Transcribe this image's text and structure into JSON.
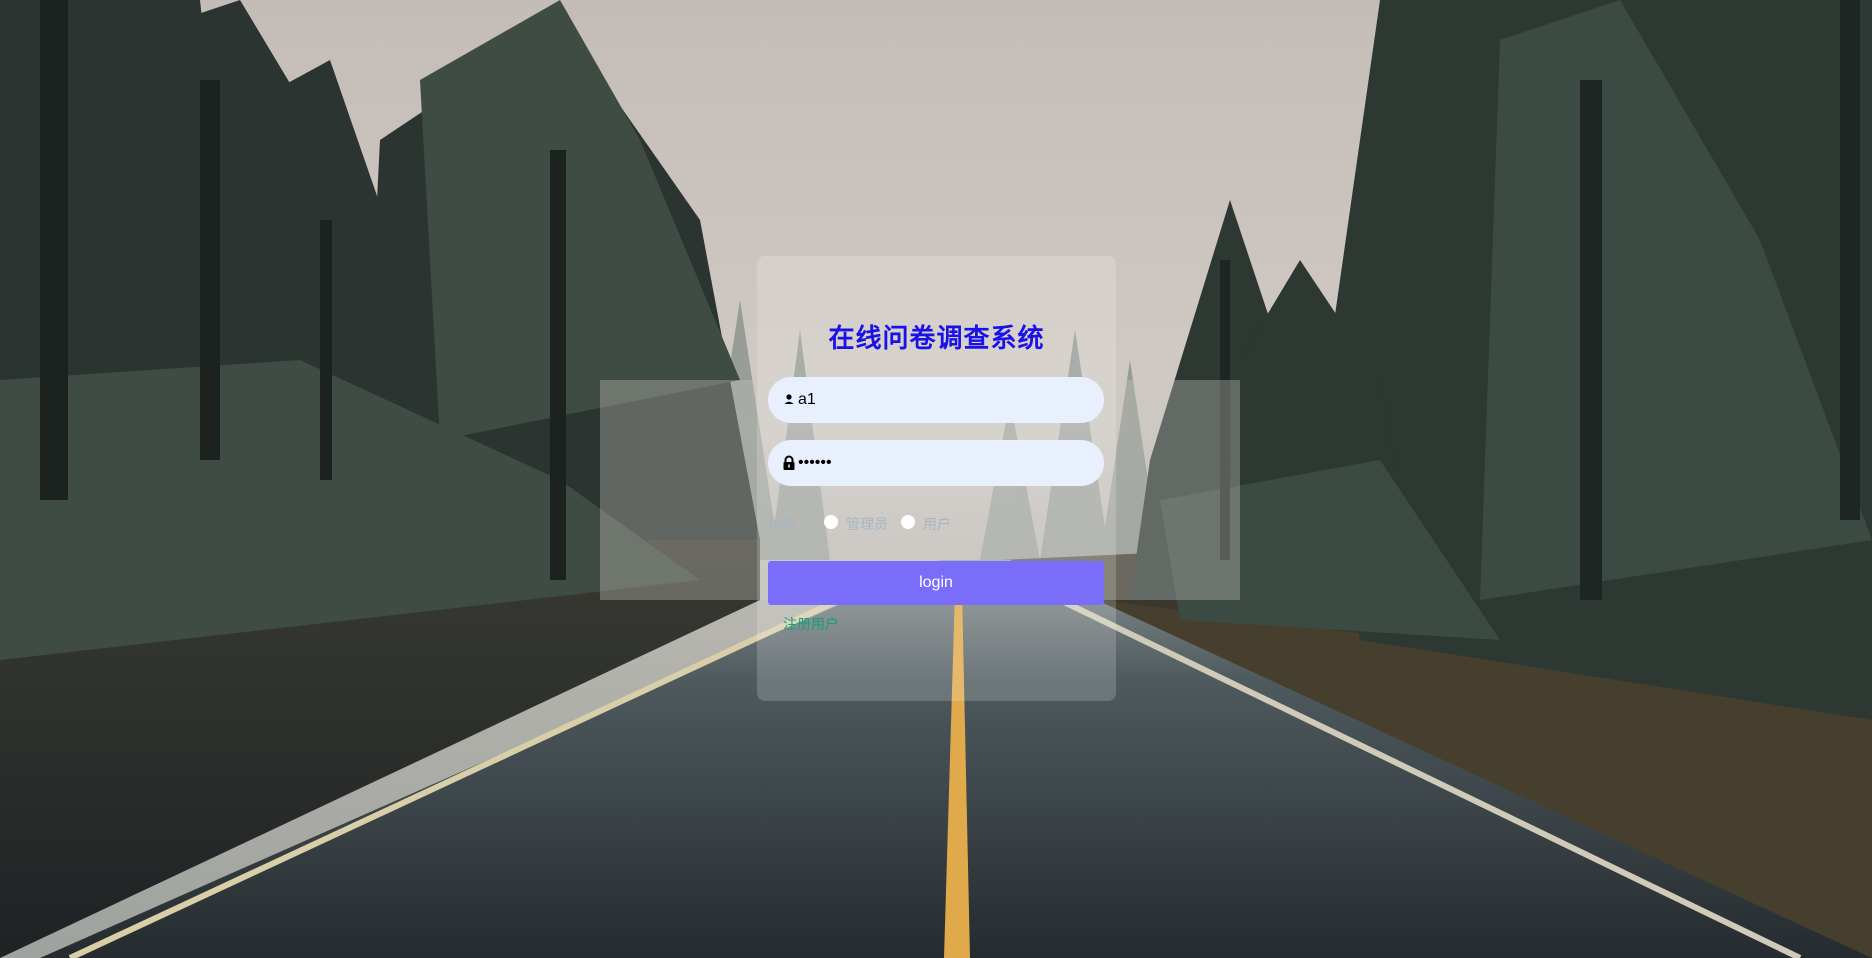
{
  "login": {
    "title": "在线问卷调查系统",
    "username": {
      "value": "a1",
      "icon": "user-icon"
    },
    "password": {
      "value": "123456",
      "icon": "lock-icon"
    },
    "role": {
      "label": "角色",
      "options": [
        "管理员",
        "用户"
      ]
    },
    "login_label": "login",
    "register_label": "注册用户"
  },
  "colors": {
    "title": "#1a10e8",
    "button": "#7a6dfa",
    "input_bg": "#e8f0fe",
    "register_link": "#14a07a"
  }
}
